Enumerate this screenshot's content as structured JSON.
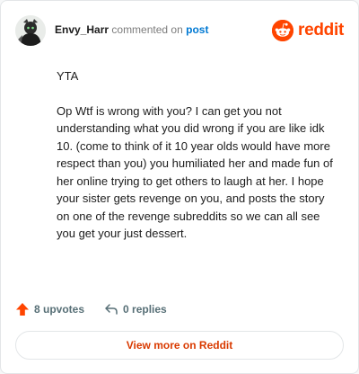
{
  "header": {
    "username": "Envy_Harr",
    "action_text": "commented on",
    "post_link": "post",
    "brand_name": "reddit"
  },
  "comment": {
    "paragraphs": [
      "YTA",
      "Op Wtf is wrong with you? I can get you not understanding what you did wrong if you are like idk 10. (come to think of it 10 year olds would have more respect than you) you humiliated her and made fun of her online trying to get others to laugh at her. I hope your sister gets revenge on you, and posts the story on one of the revenge subreddits so we can all see you get your just dessert."
    ]
  },
  "actions": {
    "upvotes_label": "8 upvotes",
    "replies_label": "0 replies"
  },
  "footer": {
    "view_more_label": "View more on Reddit"
  },
  "colors": {
    "brand": "#ff4500",
    "link": "#0079d3",
    "view_more": "#d93a00"
  },
  "icons": {
    "avatar": "avatar-icon",
    "logo": "reddit-logo-icon",
    "upvote": "upvote-arrow-icon",
    "reply": "reply-arrow-icon"
  }
}
